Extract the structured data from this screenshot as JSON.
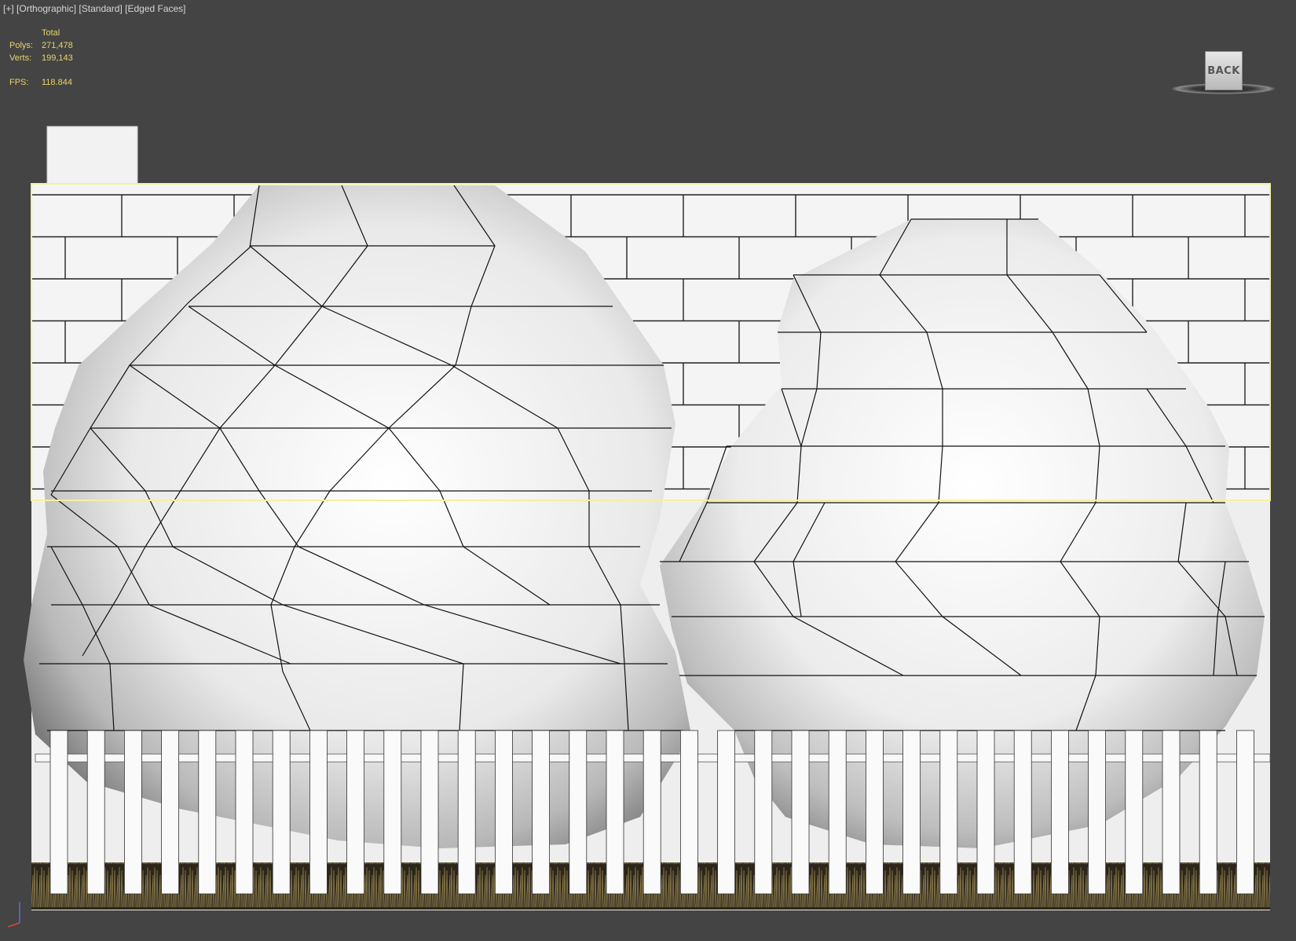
{
  "viewport": {
    "label_parts": [
      "[+]",
      "[Orthographic]",
      "[Standard]",
      "[Edged Faces]"
    ]
  },
  "stats": {
    "header": "Total",
    "polys_label": "Polys:",
    "polys_value": "271,478",
    "verts_label": "Verts:",
    "verts_value": "199,143",
    "fps_label": "FPS:",
    "fps_value": "118.844"
  },
  "viewcube": {
    "face_label": "BACK"
  },
  "colors": {
    "viewport_bg": "#444444",
    "stats_text": "#e8d36a",
    "selection": "#f2f29a",
    "wall": "#f3f3f3",
    "grass": "#3a3222"
  }
}
